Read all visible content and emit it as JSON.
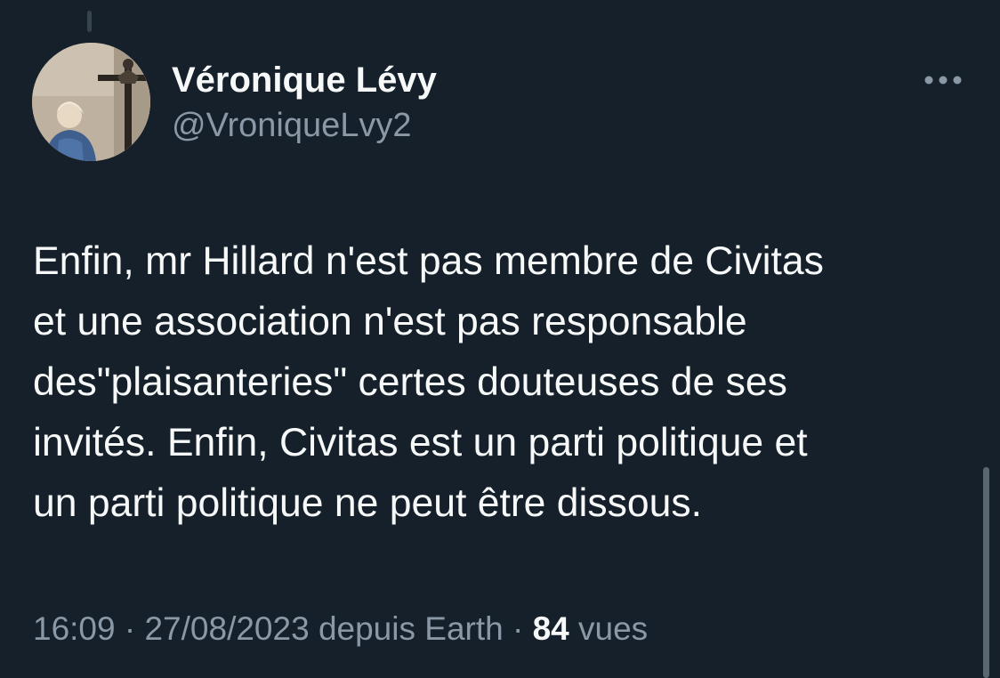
{
  "author": {
    "display_name": "Véronique Lévy",
    "handle": "@VroniqueLvy2",
    "avatar_icon": "profile-photo"
  },
  "more_icon": "more-dots-icon",
  "tweet": {
    "text": "Enfin, mr Hillard n'est pas membre de Civitas\net une association n'est pas responsable\ndes\"plaisanteries\" certes douteuses de ses\ninvités. Enfin, Civitas est un parti politique et\nun parti politique ne peut être dissous."
  },
  "meta": {
    "time": "16:09",
    "separator_1": " · ",
    "date": "27/08/2023",
    "source": " depuis Earth",
    "separator_2": " · ",
    "views_count": "84",
    "views_label": " vues"
  },
  "colors": {
    "background": "#15202b",
    "primary_text": "#f7f9f9",
    "secondary_text": "#8b98a5"
  }
}
